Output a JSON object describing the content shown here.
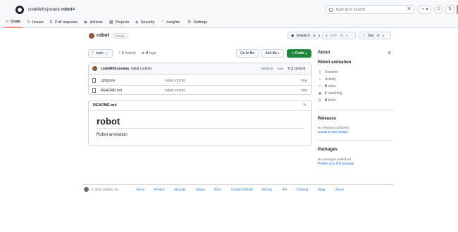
{
  "header": {
    "owner": "codeWith-jovana",
    "separator": "/",
    "repo": "robot",
    "lock_icon": "lock-icon",
    "search_placeholder": "Type [/] to search",
    "search_kbd": "⌘",
    "plus_label": "+ ▾",
    "issues_icon": "⊙",
    "pr_icon": "⇅"
  },
  "tabs": [
    {
      "label": "Code",
      "icon": "‹›"
    },
    {
      "label": "Issues",
      "icon": "⊙"
    },
    {
      "label": "Pull requests",
      "icon": "⇅"
    },
    {
      "label": "Actions",
      "icon": "▶"
    },
    {
      "label": "Projects",
      "icon": "▦"
    },
    {
      "label": "Security",
      "icon": "◈"
    },
    {
      "label": "Insights",
      "icon": "⟋"
    },
    {
      "label": "Settings",
      "icon": "⚙"
    }
  ],
  "repo": {
    "name": "robot",
    "visibility": "Private",
    "watch": {
      "label": "Unwatch",
      "count": "1"
    },
    "fork": {
      "label": "Fork",
      "count": "0"
    },
    "star": {
      "label": "Star",
      "count": "0"
    }
  },
  "toolbar": {
    "branch": "main",
    "branch_count": "1",
    "branch_label": "branch",
    "tag_count": "0",
    "tag_label": "tags",
    "goto_file": "Go to file",
    "add_file": "Add file",
    "code": "Code"
  },
  "commit": {
    "author": "codeWith-jovana",
    "message": "initial commit",
    "sha": "86f9826",
    "time": "now",
    "count": "1",
    "count_label": "commit"
  },
  "files": [
    {
      "name": ".gitignore",
      "message": "initial commit",
      "time": "now"
    },
    {
      "name": "README.md",
      "message": "initial commit",
      "time": "now"
    }
  ],
  "readme": {
    "filename": "README.md",
    "heading": "robot",
    "body": "Robot animation"
  },
  "about": {
    "title": "About",
    "description": "Robot animation",
    "items": [
      {
        "icon": "📖",
        "bold": "",
        "label": "Readme"
      },
      {
        "icon": "∿",
        "bold": "",
        "label": "Activity"
      },
      {
        "icon": "☆",
        "bold": "0",
        "label": "stars"
      },
      {
        "icon": "◉",
        "bold": "1",
        "label": "watching"
      },
      {
        "icon": "ψ",
        "bold": "0",
        "label": "forks"
      }
    ]
  },
  "releases": {
    "title": "Releases",
    "note": "No releases published",
    "link": "Create a new release"
  },
  "packages": {
    "title": "Packages",
    "note": "No packages published",
    "link": "Publish your first package"
  },
  "footer": {
    "copyright": "© 2023 GitHub, Inc.",
    "links": [
      "Terms",
      "Privacy",
      "Security",
      "Status",
      "Docs",
      "Contact GitHub",
      "Pricing",
      "API",
      "Training",
      "Blog",
      "About"
    ]
  },
  "colors": {
    "accent_green": "#1f883d",
    "link_blue": "#0969da",
    "tab_underline": "#fd8c73"
  }
}
